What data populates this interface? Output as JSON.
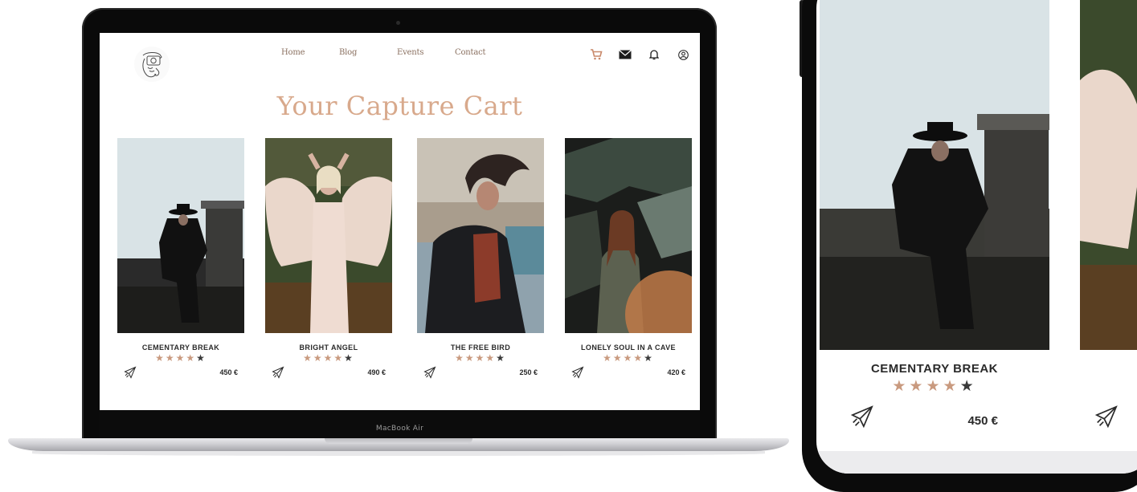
{
  "laptop": {
    "model_label": "MacBook Air"
  },
  "site": {
    "nav": [
      "Home",
      "Blog",
      "Events",
      "Contact"
    ],
    "nav_icons": [
      "cart-icon",
      "mail-icon",
      "bell-icon",
      "user-icon"
    ],
    "title": "Your Capture Cart",
    "accent_color": "#d8a98c",
    "star_color": "#c99a7f",
    "products": [
      {
        "name": "CEMENTARY BREAK",
        "rating": 4,
        "max_rating": 5,
        "price": "450 €"
      },
      {
        "name": "BRIGHT ANGEL",
        "rating": 4,
        "max_rating": 5,
        "price": "490 €"
      },
      {
        "name": "THE FREE BIRD",
        "rating": 4,
        "max_rating": 5,
        "price": "250 €"
      },
      {
        "name": "LONELY SOUL IN A CAVE",
        "rating": 4,
        "max_rating": 5,
        "price": "420 €"
      }
    ]
  },
  "phone": {
    "product": {
      "name": "CEMENTARY BREAK",
      "rating": 4,
      "max_rating": 5,
      "price": "450 €"
    }
  }
}
